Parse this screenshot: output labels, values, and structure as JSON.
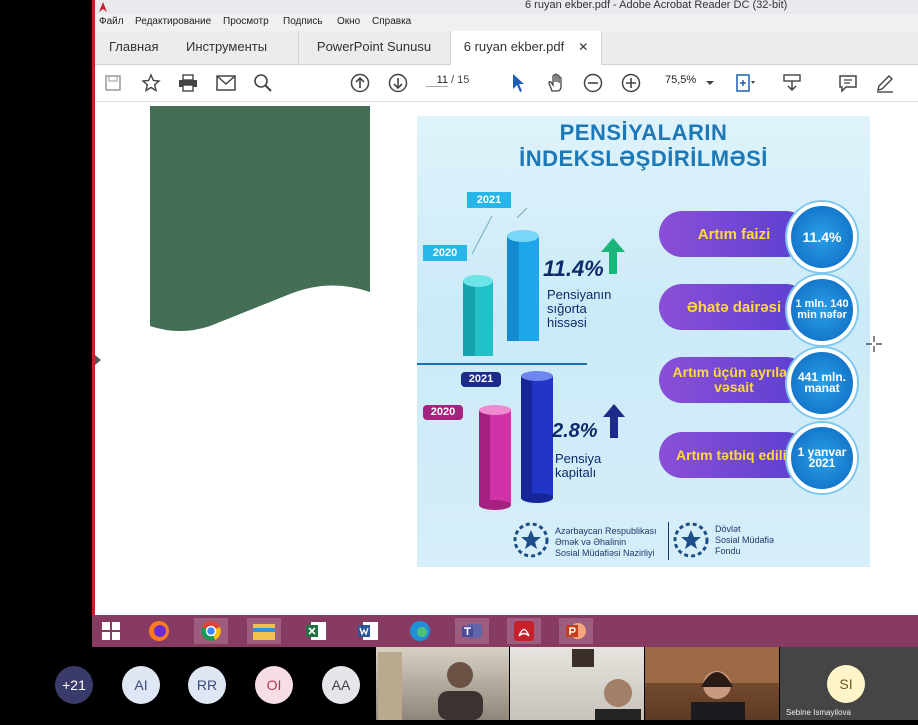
{
  "window": {
    "title": "6 ruyan ekber.pdf - Adobe Acrobat Reader DC (32-bit)"
  },
  "menu": [
    "Файл",
    "Редактирование",
    "Просмотр",
    "Подпись",
    "Окно",
    "Справка"
  ],
  "tabs": {
    "home": "Главная",
    "tools": "Инструменты",
    "doc1": "PowerPoint Sunusu",
    "doc2": "6 ruyan ekber.pdf"
  },
  "toolbar": {
    "page_current": "11",
    "page_total": "/ 15",
    "zoom": "75,5%"
  },
  "infographic": {
    "title_line1": "PENSİYALARIN",
    "title_line2": "İNDEKSLƏŞDİRİLMƏSİ",
    "top_chart": {
      "label_2020": "2020",
      "label_2021": "2021",
      "percent": "11.4%",
      "caption": [
        "Pensiyanın",
        "sığorta",
        "hissəsi"
      ]
    },
    "bottom_chart": {
      "label_2020": "2020",
      "label_2021": "2021",
      "percent": "2.8%",
      "caption": [
        "Pensiya",
        "kapitalı"
      ]
    },
    "items": [
      {
        "label": "Artım faizi",
        "value": "11.4%"
      },
      {
        "label": "Əhatə dairəsi",
        "value": "1 mln. 140 min nəfər"
      },
      {
        "label": "Artım üçün ayrılan vəsait",
        "value": "441 mln. manat"
      },
      {
        "label": "Artım tətbiq edilir",
        "value": "1 yanvar 2021"
      }
    ],
    "footer": {
      "org1": [
        "Azərbaycan Respublikası",
        "Əmək və Əhalinin",
        "Sosial Müdafiəsi Nazirliyi"
      ],
      "org2": [
        "Dövlət",
        "Sosial Müdafiə",
        "Fondu"
      ]
    }
  },
  "participants": {
    "count": "+21",
    "avatars": [
      "AI",
      "RR",
      "OI",
      "AA",
      "SI"
    ],
    "name_label": "Sebine Ismayilova"
  },
  "colors": {
    "taskbar": "#873a62",
    "acrobat_red": "#c8202a",
    "green_shape": "#446e56"
  }
}
